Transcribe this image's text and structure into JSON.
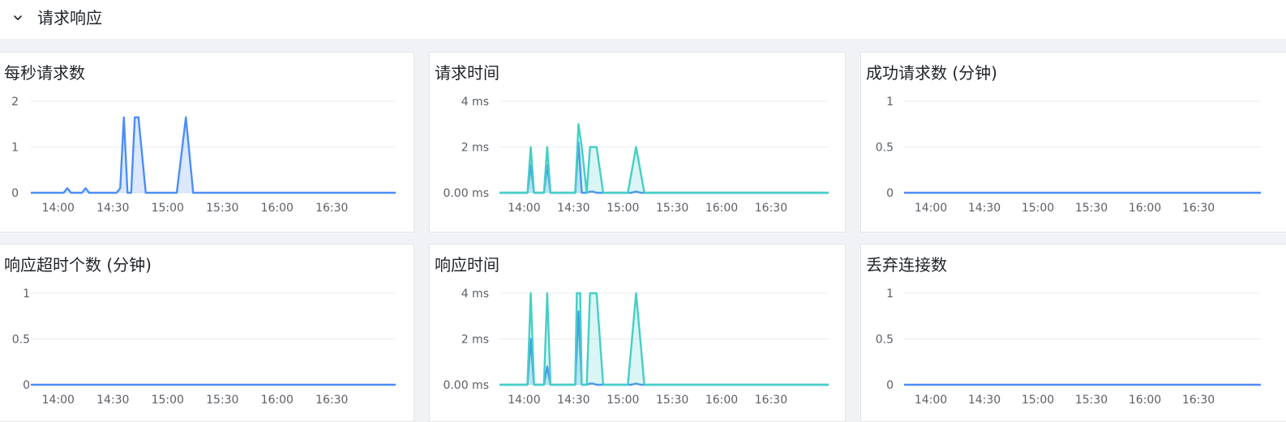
{
  "section": {
    "title": "请求响应",
    "icon": "chevron-down-icon"
  },
  "colors": {
    "blue": "#4b8ef5",
    "teal": "#44cfc6",
    "grid": "#e9ebee",
    "axis": "#5a5f66"
  },
  "panels": [
    {
      "title": "每秒请求数"
    },
    {
      "title": "请求时间"
    },
    {
      "title": "成功请求数 (分钟)"
    },
    {
      "title": "响应超时个数 (分钟)"
    },
    {
      "title": "响应时间"
    },
    {
      "title": "丢弃连接数"
    }
  ],
  "chart_data": [
    {
      "type": "area",
      "title": "每秒请求数",
      "xlabel": "",
      "ylabel": "",
      "x_tick_labels": [
        "14:00",
        "14:30",
        "15:00",
        "15:30",
        "16:00",
        "16:30"
      ],
      "y_tick_labels": [
        "0",
        "1",
        "2"
      ],
      "xlim": [
        "13:45",
        "17:05"
      ],
      "ylim": [
        0,
        2
      ],
      "grid": true,
      "series": [
        {
          "color": "#4b8ef5",
          "x": [
            "13:45",
            "14:03",
            "14:05",
            "14:07",
            "14:13",
            "14:15",
            "14:17",
            "14:32",
            "14:34",
            "14:36",
            "14:38",
            "14:40",
            "14:42",
            "14:44",
            "14:48",
            "14:50",
            "15:05",
            "15:10",
            "15:14",
            "17:05"
          ],
          "y": [
            0,
            0,
            0.1,
            0,
            0,
            0.1,
            0,
            0,
            0.1,
            1.65,
            0,
            0,
            1.65,
            1.65,
            0,
            0,
            0,
            1.65,
            0,
            0
          ]
        }
      ]
    },
    {
      "type": "area",
      "title": "请求时间",
      "xlabel": "",
      "ylabel": "",
      "x_tick_labels": [
        "14:00",
        "14:30",
        "15:00",
        "15:30",
        "16:00",
        "16:30"
      ],
      "y_tick_labels": [
        "0.00 ms",
        "2 ms",
        "4 ms"
      ],
      "xlim": [
        "13:45",
        "17:05"
      ],
      "ylim": [
        0,
        4
      ],
      "grid": true,
      "series": [
        {
          "color": "#4b8ef5",
          "x": [
            "13:45",
            "14:02",
            "14:04",
            "14:06",
            "14:12",
            "14:14",
            "14:16",
            "14:31",
            "14:33",
            "14:35",
            "14:38",
            "14:40",
            "14:42",
            "14:44",
            "14:48",
            "15:05",
            "15:08",
            "15:11",
            "17:05"
          ],
          "y": [
            0,
            0,
            1.2,
            0,
            0,
            1.2,
            0,
            0,
            2.2,
            0,
            0,
            0.05,
            0.05,
            0,
            0,
            0,
            0.05,
            0,
            0
          ]
        },
        {
          "color": "#44cfc6",
          "x": [
            "13:45",
            "14:02",
            "14:04",
            "14:06",
            "14:12",
            "14:14",
            "14:16",
            "14:31",
            "14:33",
            "14:35",
            "14:38",
            "14:40",
            "14:42",
            "14:44",
            "14:48",
            "15:03",
            "15:08",
            "15:13",
            "17:05"
          ],
          "y": [
            0,
            0,
            2,
            0,
            0,
            2,
            0,
            0,
            3,
            2,
            0,
            2,
            2,
            2,
            0,
            0,
            2,
            0,
            0
          ]
        }
      ]
    },
    {
      "type": "line",
      "title": "成功请求数 (分钟)",
      "xlabel": "",
      "ylabel": "",
      "x_tick_labels": [
        "14:00",
        "14:30",
        "15:00",
        "15:30",
        "16:00",
        "16:30"
      ],
      "y_tick_labels": [
        "0",
        "0.5",
        "1"
      ],
      "xlim": [
        "13:45",
        "17:05"
      ],
      "ylim": [
        0,
        1
      ],
      "grid": true,
      "series": [
        {
          "color": "#4b8ef5",
          "x": [
            "13:45",
            "17:05"
          ],
          "y": [
            0,
            0
          ]
        }
      ]
    },
    {
      "type": "line",
      "title": "响应超时个数 (分钟)",
      "xlabel": "",
      "ylabel": "",
      "x_tick_labels": [
        "14:00",
        "14:30",
        "15:00",
        "15:30",
        "16:00",
        "16:30"
      ],
      "y_tick_labels": [
        "0",
        "0.5",
        "1"
      ],
      "xlim": [
        "13:45",
        "17:05"
      ],
      "ylim": [
        0,
        1
      ],
      "grid": true,
      "series": [
        {
          "color": "#4b8ef5",
          "x": [
            "13:45",
            "17:05"
          ],
          "y": [
            0,
            0
          ]
        }
      ]
    },
    {
      "type": "area",
      "title": "响应时间",
      "xlabel": "",
      "ylabel": "",
      "x_tick_labels": [
        "14:00",
        "14:30",
        "15:00",
        "15:30",
        "16:00",
        "16:30"
      ],
      "y_tick_labels": [
        "0.00 ms",
        "2 ms",
        "4 ms"
      ],
      "xlim": [
        "13:45",
        "17:05"
      ],
      "ylim": [
        0,
        4
      ],
      "grid": true,
      "series": [
        {
          "color": "#4b8ef5",
          "x": [
            "13:45",
            "14:02",
            "14:04",
            "14:06",
            "14:12",
            "14:14",
            "14:16",
            "14:31",
            "14:33",
            "14:35",
            "14:38",
            "14:40",
            "14:42",
            "14:44",
            "14:48",
            "15:05",
            "15:08",
            "15:11",
            "17:05"
          ],
          "y": [
            0,
            0,
            2,
            0,
            0,
            0.8,
            0,
            0,
            3.2,
            0,
            0,
            0.05,
            0.05,
            0,
            0,
            0,
            0.05,
            0,
            0
          ]
        },
        {
          "color": "#44cfc6",
          "x": [
            "13:45",
            "14:02",
            "14:04",
            "14:06",
            "14:12",
            "14:14",
            "14:16",
            "14:31",
            "14:32",
            "14:34",
            "14:35",
            "14:38",
            "14:40",
            "14:44",
            "14:48",
            "15:03",
            "15:08",
            "15:13",
            "17:05"
          ],
          "y": [
            0,
            0,
            4,
            0,
            0,
            4,
            0,
            0,
            4,
            4,
            0,
            0,
            4,
            4,
            0,
            0,
            4,
            0,
            0
          ]
        }
      ]
    },
    {
      "type": "line",
      "title": "丢弃连接数",
      "xlabel": "",
      "ylabel": "",
      "x_tick_labels": [
        "14:00",
        "14:30",
        "15:00",
        "15:30",
        "16:00",
        "16:30"
      ],
      "y_tick_labels": [
        "0",
        "0.5",
        "1"
      ],
      "xlim": [
        "13:45",
        "17:05"
      ],
      "ylim": [
        0,
        1
      ],
      "grid": true,
      "series": [
        {
          "color": "#4b8ef5",
          "x": [
            "13:45",
            "17:05"
          ],
          "y": [
            0,
            0
          ]
        }
      ]
    }
  ]
}
